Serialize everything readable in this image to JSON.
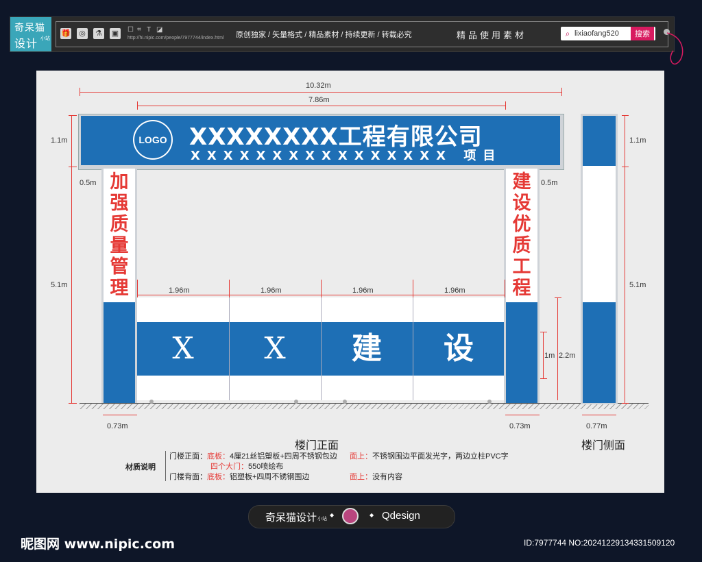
{
  "brand": {
    "line1": "奇呆猫",
    "line2": "设计",
    "small": "小站"
  },
  "toolbar": {
    "url": "http://hi.nipic.com/people/7977744/index.html",
    "slogan": "原创独家 / 矢量格式 / 精品素材 / 持续更新 / 转载必究",
    "quality": "精品使用素材",
    "search_value": "lixiaofang520",
    "search_button": "搜索"
  },
  "diagram": {
    "dim_total_width": "10.32m",
    "dim_inner_width": "7.86m",
    "dim_header_height": "1.1m",
    "dim_header_height_side": "1.1m",
    "dim_post_gap_left": "0.5m",
    "dim_post_gap_right": "0.5m",
    "dim_pillar_height_left": "5.1m",
    "dim_pillar_height_side": "5.1m",
    "dim_door_width": [
      "1.96m",
      "1.96m",
      "1.96m",
      "1.96m"
    ],
    "dim_band_height": "1m",
    "dim_door_height": "2.2m",
    "dim_pillar_width_left": "0.73m",
    "dim_pillar_width_right": "0.73m",
    "dim_side_width": "0.77m",
    "logo_text": "LOGO",
    "company_title": "XXXXXXXX工程有限公司",
    "project_line": "XXXXXXXXXXXXXXXX 项目",
    "left_pillar_text": "加强质量管理",
    "right_pillar_text": "建设优质工程",
    "gate_chars": [
      "X",
      "X",
      "建",
      "设"
    ],
    "front_caption": "楼门正面",
    "side_caption": "楼门侧面"
  },
  "materials": {
    "heading": "材质说明",
    "row1_label": "门楼正面：",
    "row1_base_label": "底板：",
    "row1_base_text": "4厘21丝铝塑板+四周不锈钢包边",
    "row1_top_label": "面上：",
    "row1_top_text": "不锈钢围边平面发光字，两边立柱PVC字",
    "row2_gate_label": "四个大门：",
    "row2_gate_text": "550喷绘布",
    "row3_label": "门楼背面：",
    "row3_base_label": "底板：",
    "row3_base_text": "铝塑板+四周不锈钢围边",
    "row3_top_label": "面上：",
    "row3_top_text": "没有内容"
  },
  "bottom_bar": {
    "brand": "奇呆猫设计",
    "brand_small": "小站",
    "design": "Qdesign"
  },
  "footer": {
    "site": "昵图网 www.nipic.com",
    "id_text": "ID:7977744 NO:20241229134331509120"
  },
  "colors": {
    "accent_blue": "#1e6fb5",
    "accent_red": "#e53935",
    "brand_teal": "#3aa6b9",
    "search_pink": "#d81b60"
  }
}
